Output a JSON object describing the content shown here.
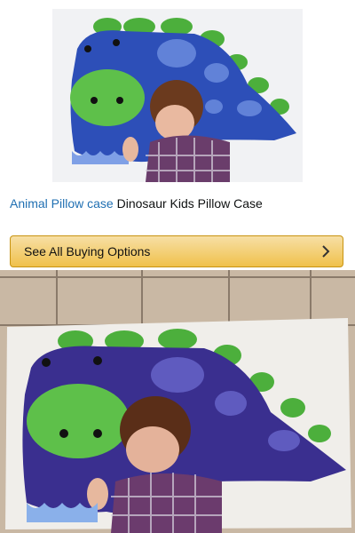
{
  "product": {
    "image_alt": "dinosaur-pillow-with-sleeping-boy",
    "brand_link": "Animal Pillow case",
    "title": "Dinosaur Kids Pillow Case"
  },
  "buy_button": {
    "label": "See All Buying Options",
    "icon": "chevron-right-icon"
  },
  "customer_photo": {
    "image_alt": "pillow-case-print-on-tile-floor"
  },
  "colors": {
    "link": "#1f6fb2",
    "button_top": "#f7dfa5",
    "button_bottom": "#f0c14b",
    "button_border": "#c89411",
    "dino_blue": "#2d4fb8",
    "dino_green": "#46b24a"
  }
}
